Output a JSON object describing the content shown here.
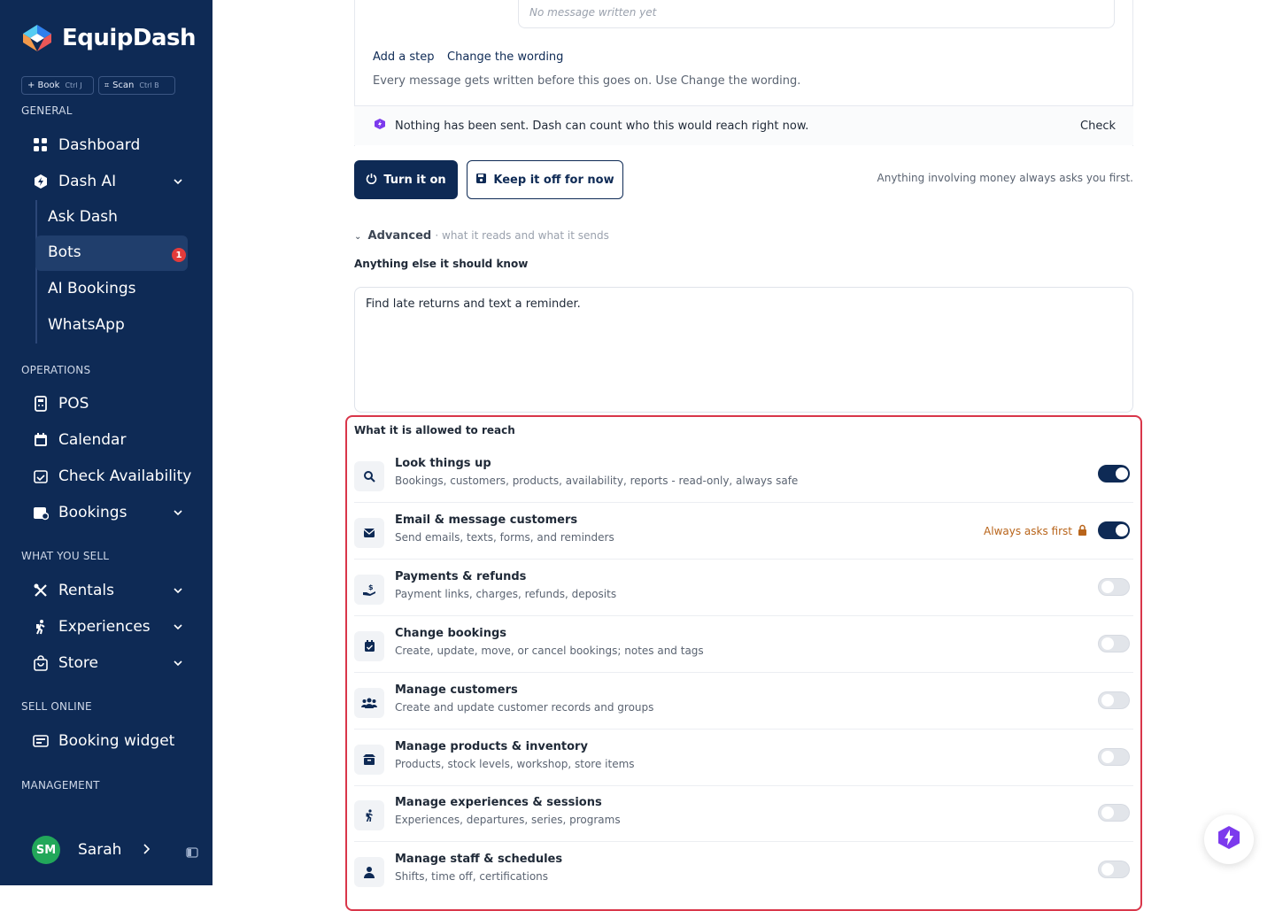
{
  "brand": {
    "name": "EquipDash"
  },
  "quick_actions": [
    {
      "label": "+ Book",
      "shortcut": "Ctrl J"
    },
    {
      "label": "Scan",
      "shortcut": "Ctrl B"
    }
  ],
  "sidebar": {
    "sections": [
      "GENERAL",
      "OPERATIONS",
      "WHAT YOU SELL",
      "SELL ONLINE",
      "MANAGEMENT"
    ],
    "items": {
      "dashboard": "Dashboard",
      "dash_ai": "Dash AI",
      "ask_dash": "Ask Dash",
      "bots": "Bots",
      "bots_badge": "1",
      "ai_bookings": "AI Bookings",
      "whatsapp": "WhatsApp",
      "pos": "POS",
      "calendar": "Calendar",
      "check_availability": "Check Availability",
      "bookings": "Bookings",
      "rentals": "Rentals",
      "experiences": "Experiences",
      "store": "Store",
      "booking_widget": "Booking widget"
    },
    "user": {
      "initials": "SM",
      "name": "Sarah"
    }
  },
  "editor": {
    "message_placeholder": "No message written yet",
    "add_step": "Add a step",
    "change_wording": "Change the wording",
    "note": "Every message gets written before this goes on. Use Change the wording.",
    "banner": "Nothing has been sent. Dash can count who this would reach right now.",
    "check": "Check",
    "turn_on": "Turn it on",
    "keep_off": "Keep it off for now",
    "money_hint": "Anything involving money always asks you first.",
    "advanced": "Advanced",
    "advanced_desc": "· what it reads and what it sends",
    "instructions_label": "Anything else it should know",
    "instructions_value": "Find late returns and text a reminder."
  },
  "permissions": {
    "title": "What it is allowed to reach",
    "always_asks": "Always asks first",
    "rows": [
      {
        "title": "Look things up",
        "desc": "Bookings, customers, products, availability, reports - read-only, always safe",
        "on": true,
        "icon": "search-icon"
      },
      {
        "title": "Email & message customers",
        "desc": "Send emails, texts, forms, and reminders",
        "on": true,
        "icon": "envelope-icon"
      },
      {
        "title": "Payments & refunds",
        "desc": "Payment links, charges, refunds, deposits",
        "on": false,
        "icon": "hand-dollar-icon"
      },
      {
        "title": "Change bookings",
        "desc": "Create, update, move, or cancel bookings; notes and tags",
        "on": false,
        "icon": "calendar-check-icon"
      },
      {
        "title": "Manage customers",
        "desc": "Create and update customer records and groups",
        "on": false,
        "icon": "users-icon"
      },
      {
        "title": "Manage products & inventory",
        "desc": "Products, stock levels, workshop, store items",
        "on": false,
        "icon": "box-icon"
      },
      {
        "title": "Manage experiences & sessions",
        "desc": "Experiences, departures, series, programs",
        "on": false,
        "icon": "hiker-icon"
      },
      {
        "title": "Manage staff & schedules",
        "desc": "Shifts, time off, certifications",
        "on": false,
        "icon": "person-icon"
      }
    ]
  }
}
